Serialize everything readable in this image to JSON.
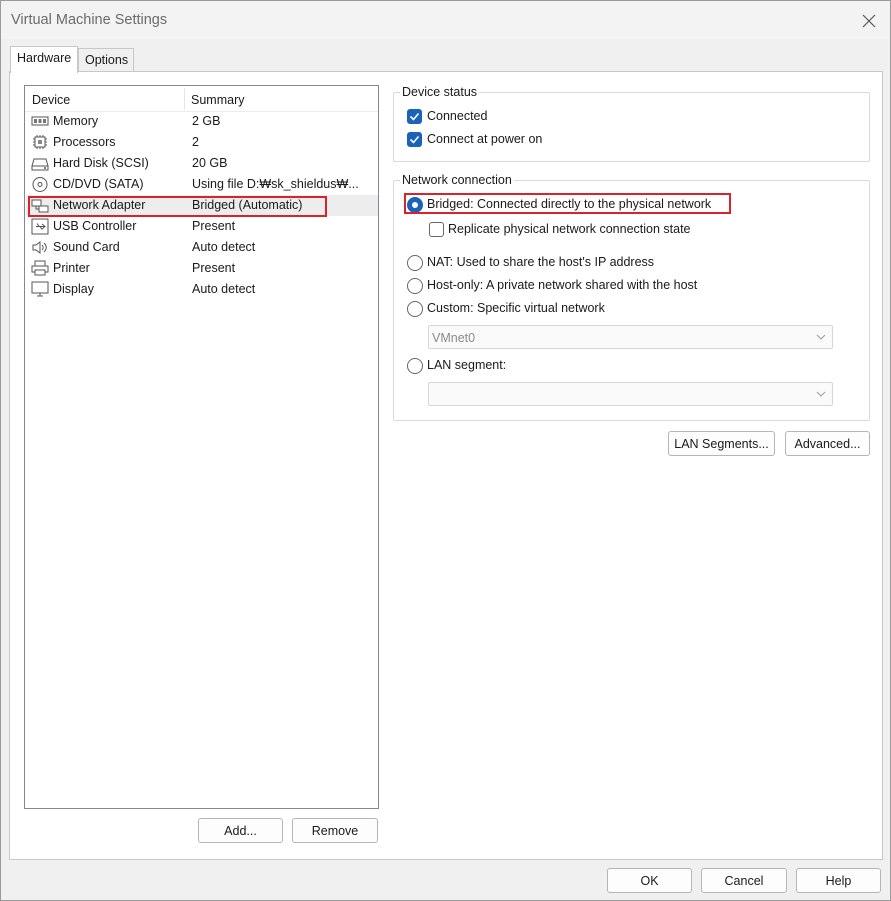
{
  "window": {
    "title": "Virtual Machine Settings"
  },
  "tabs": [
    {
      "label": "Hardware"
    },
    {
      "label": "Options"
    }
  ],
  "device_list": {
    "columns": {
      "device": "Device",
      "summary": "Summary"
    },
    "rows": [
      {
        "icon": "memory-icon",
        "device": "Memory",
        "summary": "2 GB"
      },
      {
        "icon": "processor-icon",
        "device": "Processors",
        "summary": "2"
      },
      {
        "icon": "hard-disk-icon",
        "device": "Hard Disk (SCSI)",
        "summary": "20 GB"
      },
      {
        "icon": "cd-dvd-icon",
        "device": "CD/DVD (SATA)",
        "summary": "Using file D:₩sk_shieldus₩..."
      },
      {
        "icon": "network-adapter-icon",
        "device": "Network Adapter",
        "summary": "Bridged (Automatic)"
      },
      {
        "icon": "usb-icon",
        "device": "USB Controller",
        "summary": "Present"
      },
      {
        "icon": "speaker-icon",
        "device": "Sound Card",
        "summary": "Auto detect"
      },
      {
        "icon": "printer-icon",
        "device": "Printer",
        "summary": "Present"
      },
      {
        "icon": "display-icon",
        "device": "Display",
        "summary": "Auto detect"
      }
    ],
    "selected_index": 4
  },
  "list_buttons": {
    "add": "Add...",
    "remove": "Remove"
  },
  "device_status": {
    "title": "Device status",
    "connected": {
      "label": "Connected",
      "checked": true
    },
    "connect_at_power_on": {
      "label": "Connect at power on",
      "checked": true
    }
  },
  "network_connection": {
    "title": "Network connection",
    "bridged": {
      "label": "Bridged: Connected directly to the physical network",
      "selected": true
    },
    "replicate": {
      "label": "Replicate physical network connection state",
      "checked": false
    },
    "nat": {
      "label": "NAT: Used to share the host's IP address",
      "selected": false
    },
    "host_only": {
      "label": "Host-only: A private network shared with the host",
      "selected": false
    },
    "custom": {
      "label": "Custom: Specific virtual network",
      "selected": false
    },
    "custom_network_value": "VMnet0",
    "lan_segment": {
      "label": "LAN segment:",
      "selected": false
    },
    "lan_segment_value": ""
  },
  "panel_buttons": {
    "lan_segments": "LAN Segments...",
    "advanced": "Advanced..."
  },
  "dialog_buttons": {
    "ok": "OK",
    "cancel": "Cancel",
    "help": "Help"
  },
  "colors": {
    "accent": "#1a63b8",
    "highlight_box": "#d9232a"
  }
}
